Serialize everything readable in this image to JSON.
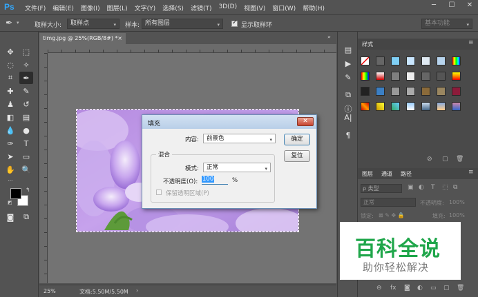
{
  "app": {
    "logo": "Ps",
    "menu": [
      "文件(F)",
      "编辑(E)",
      "图像(I)",
      "图层(L)",
      "文字(Y)",
      "选择(S)",
      "滤镜(T)",
      "3D(D)",
      "视图(V)",
      "窗口(W)",
      "帮助(H)"
    ],
    "window_controls": [
      "─",
      "☐",
      "✕"
    ]
  },
  "options": {
    "sample_size_label": "取样大小:",
    "sample_size_value": "取样点",
    "sample_label": "样本:",
    "sample_value": "所有图层",
    "show_ring_label": "显示取样环",
    "workspace": "基本功能"
  },
  "document": {
    "tab_title": "timg.jpg @ 25%(RGB/8#) *",
    "zoom": "25%",
    "doc_info": "文档:5.50M/5.50M"
  },
  "right_panel": {
    "styles_tab": "样式",
    "layers_tabs": [
      "图层",
      "通道",
      "路径"
    ],
    "filter_kind": "ρ 类型",
    "blend_mode": "正常",
    "opacity_label": "不透明度:",
    "opacity_value": "100%",
    "lock_label": "锁定:",
    "fill_label": "填充:",
    "fill_value": "100%"
  },
  "dialog": {
    "title": "填充",
    "close": "✕",
    "content_label": "内容:",
    "content_value": "前景色",
    "ok": "确定",
    "reset": "复位",
    "blend_group": "混合",
    "mode_label": "模式:",
    "mode_value": "正常",
    "opacity_label": "不透明度(O):",
    "opacity_value": "100",
    "opacity_unit": "%",
    "preserve_label": "保留透明区域(P)"
  },
  "watermark": {
    "title": "百科全说",
    "subtitle": "助你轻松解决"
  },
  "colors": {
    "ui_bg": "#535353",
    "canvas_bg": "#737373",
    "accent_blue": "#31a8ff",
    "watermark_green": "#1fa64a"
  }
}
